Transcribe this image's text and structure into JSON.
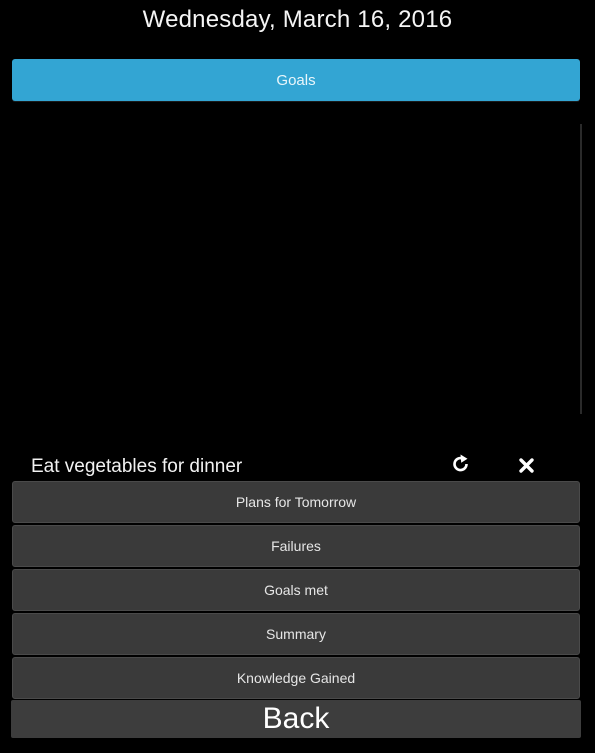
{
  "header": {
    "date_title": "Wednesday, March 16, 2016"
  },
  "goals_button": {
    "label": "Goals",
    "color": "#33a5d3"
  },
  "goal_item": {
    "text": "Eat vegetables for dinner",
    "actions": [
      {
        "icon": "refresh-icon"
      },
      {
        "icon": "close-icon"
      }
    ]
  },
  "menu": {
    "items": [
      {
        "label": "Plans for Tomorrow"
      },
      {
        "label": "Failures"
      },
      {
        "label": "Goals met"
      },
      {
        "label": "Summary"
      },
      {
        "label": "Knowledge Gained"
      }
    ]
  },
  "footer": {
    "back_label": "Back"
  }
}
